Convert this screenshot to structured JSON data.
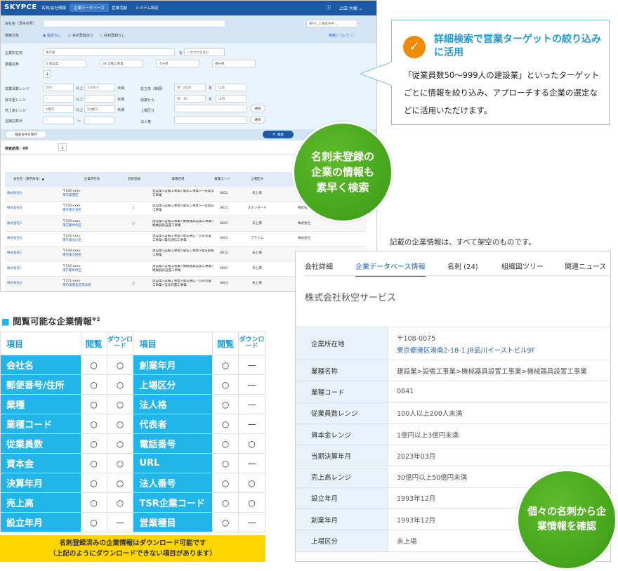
{
  "app": {
    "logo": "SKYPCE",
    "nav": [
      "名刺/会社情報",
      "企業データベース",
      "営業活動",
      "システム設定"
    ],
    "active_nav": 1,
    "help_icon": "question-circle-icon",
    "user": "上田 大樹"
  },
  "filters": {
    "company_name_label": "会社名（漢字商号）",
    "saved_conditions": "保存した検索条件",
    "target_label": "検索対象",
    "target_options": [
      "指定なし",
      "名刺登録あり",
      "名刺登録なし"
    ],
    "target_selected": 0,
    "about_search": "検索について",
    "location_label": "企業所在地",
    "location_value": "東京都",
    "location_suffix": "を",
    "location_mode": "いずれかを含む",
    "industry_label": "業種名称",
    "industry_values": [
      "D 建設業",
      "08 設備工事業",
      "小分類",
      "細分類"
    ],
    "employees_label": "従業員数レンジ",
    "employees_from": "50人",
    "employees_to": "1,000人",
    "capital_label": "資本金レンジ",
    "capital_from": "--",
    "capital_to": "--",
    "sales_label": "売上高レンジ",
    "sales_from": "5億円",
    "sales_to": "50億円",
    "fiscal_label": "当期決算月",
    "fiscal_from": "--",
    "fiscal_to": "--",
    "above": "以上",
    "below": "未満",
    "tilde": "〜",
    "founded_label": "設立年（西暦）",
    "founded_placeholder": "例：2000",
    "founded_unit": "年",
    "founded_mode": "以前",
    "since_label": "創業から",
    "since_placeholder": "例：10",
    "since_unit": "年",
    "since_mode": "以内",
    "listed_label": "上場区分",
    "corp_label": "法人格",
    "select_label": "選択",
    "save_button": "検索条件を保存",
    "search_button": "検索"
  },
  "results": {
    "count_label": "検索結果：4件",
    "headers": [
      "会社名（漢字商号）▲",
      "企業所在地",
      "名刺登録",
      "業種名称",
      "業種コード",
      "上場区分"
    ],
    "rows": [
      {
        "name": "株式会社A",
        "zip": "〒106-xxxx",
        "addr": "東京都港区",
        "card": "",
        "industry": "建設業>設備工事業>電気工事業>一般電気工事業",
        "code": "0811",
        "listed": "未上場",
        "corp": ""
      },
      {
        "name": "株式会社B",
        "zip": "〒150-xxxx",
        "addr": "東京都渋谷区",
        "card": "○",
        "industry": "建設業>設備工事業>電気工事業>一般電気工事業",
        "code": "0811",
        "listed": "スタンダード",
        "corp": "株式会社"
      },
      {
        "name": "株式会社C",
        "zip": "〒103-xxxx",
        "addr": "東京都中央区",
        "card": "○",
        "industry": "建設業>設備工事業>機械器具設置工事業>機械器具設置工事業",
        "code": "0841",
        "listed": "未上場",
        "corp": "株式会社"
      },
      {
        "name": "株式会社D",
        "zip": "〒142-xxxx",
        "addr": "東京都品川区",
        "card": "",
        "industry": "建設業>設備工事業>電気通信・信号装置工事業>電気通信工事業",
        "code": "0821",
        "listed": "プライム",
        "corp": "株式会社"
      },
      {
        "name": "株式会社E",
        "zip": "〒144-xxxx",
        "addr": "東京都大田区",
        "card": "",
        "industry": "建設業>設備工事業>電気工事業>電気配線工事業",
        "code": "0812",
        "listed": "未上場",
        "corp": ""
      },
      {
        "name": "株式会社F",
        "zip": "〒152-xxxx",
        "addr": "東京都目黒区",
        "card": "",
        "industry": "建設業>設備工事業>機械器具設置工事業>機械器具設置工事業",
        "code": "0841",
        "listed": "未上場",
        "corp": ""
      },
      {
        "name": "株式会社G",
        "zip": "〒171-xxxx",
        "addr": "東京都豊島区南池袋",
        "card": "○",
        "industry": "建設業>設備工事業>電気通信・信号装置工事業>信号装置工事業",
        "code": "0823",
        "listed": "未上場",
        "corp": ""
      }
    ]
  },
  "callout": {
    "title": "詳細検索で営業ターゲットの絞り込みに活用",
    "body": "「従業員数50〜999人の建設業」といったターゲットごとに情報を絞り込み、アプローチする企業の選定などに活用いただけます。"
  },
  "badge1": "名刺未登録の企業の情報も素早く検索",
  "badge2": "個々の名刺から企業情報を確認",
  "note": "記載の企業情報は、すべて架空のものです。",
  "detail": {
    "tabs": [
      "会社詳細",
      "企業データベース情報",
      "名刺 (24)",
      "組織図ツリー",
      "関連ニュース"
    ],
    "active_tab": 1,
    "company": "株式会社秋空サービス",
    "rows": [
      {
        "k": "企業所在地",
        "v": "〒108-0075",
        "v2": "東京都港区港南2-18-1 JR品川イーストビル9F"
      },
      {
        "k": "業種名称",
        "v": "建設業>設備工事業>機械器具設置工事業>機械器具設置工事業"
      },
      {
        "k": "業種コード",
        "v": "0841"
      },
      {
        "k": "従業員数レンジ",
        "v": "100人以上200人未満"
      },
      {
        "k": "資本金レンジ",
        "v": "1億円以上3億円未満"
      },
      {
        "k": "当期決算年月",
        "v": "2023年03月"
      },
      {
        "k": "売上高レンジ",
        "v": "30億円以上50億円未満"
      },
      {
        "k": "設立年月",
        "v": "1993年12月"
      },
      {
        "k": "創業年月",
        "v": "1993年12月"
      },
      {
        "k": "上場区分",
        "v": "未上場"
      }
    ]
  },
  "spec": {
    "title": "閲覧可能な企業情報",
    "title_sup": "※2",
    "headers": [
      "項目",
      "閲覧",
      "ダウンロード",
      "項目",
      "閲覧",
      "ダウンロード"
    ],
    "rows": [
      [
        "会社名",
        "○",
        "○",
        "創業年月",
        "○",
        "—"
      ],
      [
        "郵便番号/住所",
        "○",
        "○",
        "上場区分",
        "○",
        "—"
      ],
      [
        "業種",
        "○",
        "○",
        "法人格",
        "○",
        "—"
      ],
      [
        "業種コード",
        "○",
        "○",
        "代表者",
        "○",
        "—"
      ],
      [
        "従業員数",
        "○",
        "○",
        "電話番号",
        "○",
        "○"
      ],
      [
        "資本金",
        "○",
        "○",
        "URL",
        "○",
        "—"
      ],
      [
        "決算年月",
        "○",
        "○",
        "法人番号",
        "○",
        "○"
      ],
      [
        "売上高",
        "○",
        "○",
        "TSR企業コード",
        "○",
        "○"
      ],
      [
        "設立年月",
        "○",
        "—",
        "営業種目",
        "○",
        "—"
      ]
    ],
    "footer": "名刺登録済みの企業情報はダウンロード可能です\n（上記のようにダウンロードできない項目があります）"
  },
  "colors": {
    "brand": "#1c5aa8",
    "accent": "#22b5ea",
    "green": "#3a9a17",
    "yellow": "#ffd500"
  }
}
